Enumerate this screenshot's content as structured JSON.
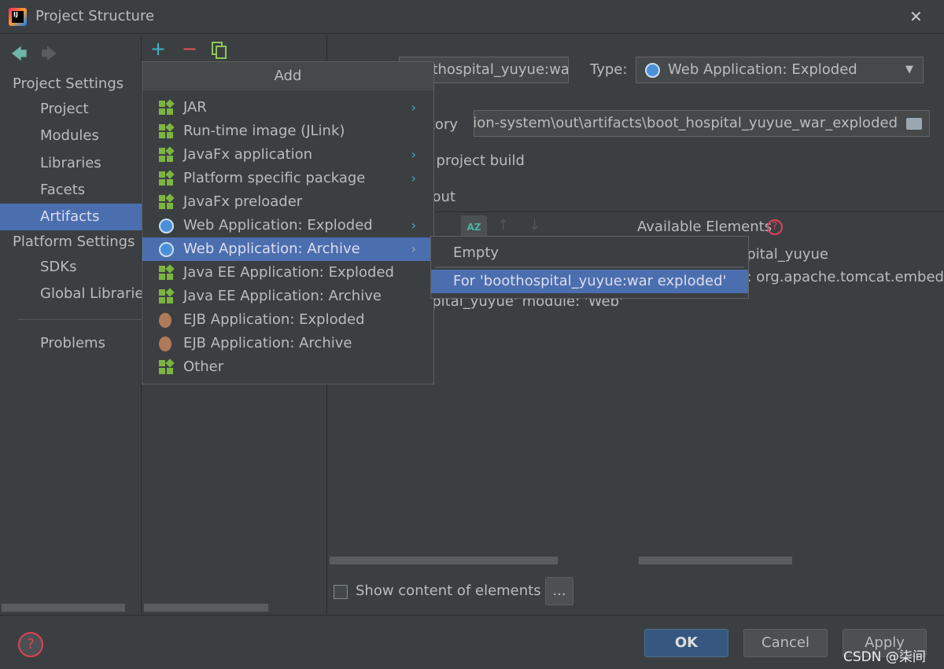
{
  "window": {
    "title": "Project Structure",
    "close": "✕"
  },
  "sidebar": {
    "project_settings": "Project Settings",
    "items": [
      "Project",
      "Modules",
      "Libraries",
      "Facets",
      "Artifacts"
    ],
    "platform_settings": "Platform Settings",
    "platform_items": [
      "SDKs",
      "Global Libraries"
    ],
    "problems": "Problems"
  },
  "toolbar": {
    "add": "+",
    "remove": "−"
  },
  "main": {
    "name_value": "boothospital_yuyue:war exploded",
    "type_label": "Type:",
    "type_value": "Web Application: Exploded",
    "dir_label": "Output directory:",
    "dir_value": "hospital-reservation-system\\out\\artifacts\\boot_hospital_yuyue_war_exploded",
    "build_label": "Include in project build",
    "layout_label": "Output Layout",
    "available": "Available Elements",
    "tree": [
      "boothospital_yuyue",
      "Maven: org.apache.tomcat.embed:",
      "'boothospital_yuyue' module: 'Web'"
    ],
    "show_content": "Show content of elements",
    "more": "..."
  },
  "popup": {
    "title": "Add",
    "items": [
      {
        "label": "JAR",
        "icon": "artifact-icon",
        "sub": true
      },
      {
        "label": "Run-time image (JLink)",
        "icon": "artifact-icon",
        "sub": false
      },
      {
        "label": "JavaFx application",
        "icon": "artifact-icon",
        "sub": true
      },
      {
        "label": "Platform specific package",
        "icon": "artifact-icon",
        "sub": true
      },
      {
        "label": "JavaFx preloader",
        "icon": "artifact-icon",
        "sub": false
      },
      {
        "label": "Web Application: Exploded",
        "icon": "globe-icon",
        "sub": true
      },
      {
        "label": "Web Application: Archive",
        "icon": "globe-icon",
        "sub": true,
        "selected": true
      },
      {
        "label": "Java EE Application: Exploded",
        "icon": "artifact-icon",
        "sub": false
      },
      {
        "label": "Java EE Application: Archive",
        "icon": "artifact-icon",
        "sub": false
      },
      {
        "label": "EJB Application: Exploded",
        "icon": "bean-icon",
        "sub": false
      },
      {
        "label": "EJB Application: Archive",
        "icon": "bean-icon",
        "sub": false
      },
      {
        "label": "Other",
        "icon": "artifact-icon",
        "sub": false
      }
    ]
  },
  "submenu": {
    "items": [
      "Empty",
      "For 'boothospital_yuyue:war exploded'"
    ]
  },
  "buttons": {
    "ok": "OK",
    "cancel": "Cancel",
    "apply": "Apply",
    "help": "?"
  },
  "watermark": "CSDN @柒间",
  "colors": {
    "selection": "#4b6eaf",
    "background": "#3c3f41",
    "accent_add": "#3fb0c8",
    "accent_remove": "#e05555"
  }
}
